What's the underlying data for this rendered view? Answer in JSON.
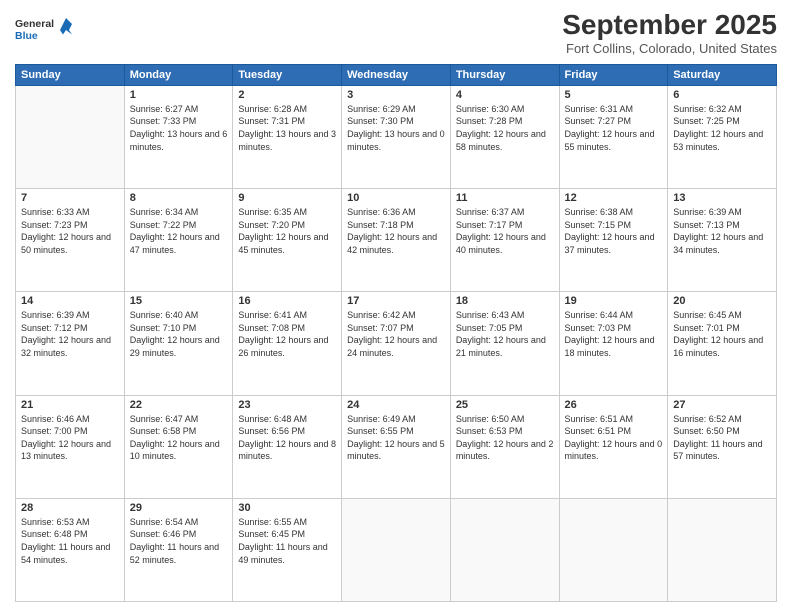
{
  "logo": {
    "line1": "General",
    "line2": "Blue"
  },
  "header": {
    "month": "September 2025",
    "location": "Fort Collins, Colorado, United States"
  },
  "weekdays": [
    "Sunday",
    "Monday",
    "Tuesday",
    "Wednesday",
    "Thursday",
    "Friday",
    "Saturday"
  ],
  "weeks": [
    [
      {
        "day": "",
        "sunrise": "",
        "sunset": "",
        "daylight": ""
      },
      {
        "day": "1",
        "sunrise": "Sunrise: 6:27 AM",
        "sunset": "Sunset: 7:33 PM",
        "daylight": "Daylight: 13 hours and 6 minutes."
      },
      {
        "day": "2",
        "sunrise": "Sunrise: 6:28 AM",
        "sunset": "Sunset: 7:31 PM",
        "daylight": "Daylight: 13 hours and 3 minutes."
      },
      {
        "day": "3",
        "sunrise": "Sunrise: 6:29 AM",
        "sunset": "Sunset: 7:30 PM",
        "daylight": "Daylight: 13 hours and 0 minutes."
      },
      {
        "day": "4",
        "sunrise": "Sunrise: 6:30 AM",
        "sunset": "Sunset: 7:28 PM",
        "daylight": "Daylight: 12 hours and 58 minutes."
      },
      {
        "day": "5",
        "sunrise": "Sunrise: 6:31 AM",
        "sunset": "Sunset: 7:27 PM",
        "daylight": "Daylight: 12 hours and 55 minutes."
      },
      {
        "day": "6",
        "sunrise": "Sunrise: 6:32 AM",
        "sunset": "Sunset: 7:25 PM",
        "daylight": "Daylight: 12 hours and 53 minutes."
      }
    ],
    [
      {
        "day": "7",
        "sunrise": "Sunrise: 6:33 AM",
        "sunset": "Sunset: 7:23 PM",
        "daylight": "Daylight: 12 hours and 50 minutes."
      },
      {
        "day": "8",
        "sunrise": "Sunrise: 6:34 AM",
        "sunset": "Sunset: 7:22 PM",
        "daylight": "Daylight: 12 hours and 47 minutes."
      },
      {
        "day": "9",
        "sunrise": "Sunrise: 6:35 AM",
        "sunset": "Sunset: 7:20 PM",
        "daylight": "Daylight: 12 hours and 45 minutes."
      },
      {
        "day": "10",
        "sunrise": "Sunrise: 6:36 AM",
        "sunset": "Sunset: 7:18 PM",
        "daylight": "Daylight: 12 hours and 42 minutes."
      },
      {
        "day": "11",
        "sunrise": "Sunrise: 6:37 AM",
        "sunset": "Sunset: 7:17 PM",
        "daylight": "Daylight: 12 hours and 40 minutes."
      },
      {
        "day": "12",
        "sunrise": "Sunrise: 6:38 AM",
        "sunset": "Sunset: 7:15 PM",
        "daylight": "Daylight: 12 hours and 37 minutes."
      },
      {
        "day": "13",
        "sunrise": "Sunrise: 6:39 AM",
        "sunset": "Sunset: 7:13 PM",
        "daylight": "Daylight: 12 hours and 34 minutes."
      }
    ],
    [
      {
        "day": "14",
        "sunrise": "Sunrise: 6:39 AM",
        "sunset": "Sunset: 7:12 PM",
        "daylight": "Daylight: 12 hours and 32 minutes."
      },
      {
        "day": "15",
        "sunrise": "Sunrise: 6:40 AM",
        "sunset": "Sunset: 7:10 PM",
        "daylight": "Daylight: 12 hours and 29 minutes."
      },
      {
        "day": "16",
        "sunrise": "Sunrise: 6:41 AM",
        "sunset": "Sunset: 7:08 PM",
        "daylight": "Daylight: 12 hours and 26 minutes."
      },
      {
        "day": "17",
        "sunrise": "Sunrise: 6:42 AM",
        "sunset": "Sunset: 7:07 PM",
        "daylight": "Daylight: 12 hours and 24 minutes."
      },
      {
        "day": "18",
        "sunrise": "Sunrise: 6:43 AM",
        "sunset": "Sunset: 7:05 PM",
        "daylight": "Daylight: 12 hours and 21 minutes."
      },
      {
        "day": "19",
        "sunrise": "Sunrise: 6:44 AM",
        "sunset": "Sunset: 7:03 PM",
        "daylight": "Daylight: 12 hours and 18 minutes."
      },
      {
        "day": "20",
        "sunrise": "Sunrise: 6:45 AM",
        "sunset": "Sunset: 7:01 PM",
        "daylight": "Daylight: 12 hours and 16 minutes."
      }
    ],
    [
      {
        "day": "21",
        "sunrise": "Sunrise: 6:46 AM",
        "sunset": "Sunset: 7:00 PM",
        "daylight": "Daylight: 12 hours and 13 minutes."
      },
      {
        "day": "22",
        "sunrise": "Sunrise: 6:47 AM",
        "sunset": "Sunset: 6:58 PM",
        "daylight": "Daylight: 12 hours and 10 minutes."
      },
      {
        "day": "23",
        "sunrise": "Sunrise: 6:48 AM",
        "sunset": "Sunset: 6:56 PM",
        "daylight": "Daylight: 12 hours and 8 minutes."
      },
      {
        "day": "24",
        "sunrise": "Sunrise: 6:49 AM",
        "sunset": "Sunset: 6:55 PM",
        "daylight": "Daylight: 12 hours and 5 minutes."
      },
      {
        "day": "25",
        "sunrise": "Sunrise: 6:50 AM",
        "sunset": "Sunset: 6:53 PM",
        "daylight": "Daylight: 12 hours and 2 minutes."
      },
      {
        "day": "26",
        "sunrise": "Sunrise: 6:51 AM",
        "sunset": "Sunset: 6:51 PM",
        "daylight": "Daylight: 12 hours and 0 minutes."
      },
      {
        "day": "27",
        "sunrise": "Sunrise: 6:52 AM",
        "sunset": "Sunset: 6:50 PM",
        "daylight": "Daylight: 11 hours and 57 minutes."
      }
    ],
    [
      {
        "day": "28",
        "sunrise": "Sunrise: 6:53 AM",
        "sunset": "Sunset: 6:48 PM",
        "daylight": "Daylight: 11 hours and 54 minutes."
      },
      {
        "day": "29",
        "sunrise": "Sunrise: 6:54 AM",
        "sunset": "Sunset: 6:46 PM",
        "daylight": "Daylight: 11 hours and 52 minutes."
      },
      {
        "day": "30",
        "sunrise": "Sunrise: 6:55 AM",
        "sunset": "Sunset: 6:45 PM",
        "daylight": "Daylight: 11 hours and 49 minutes."
      },
      {
        "day": "",
        "sunrise": "",
        "sunset": "",
        "daylight": ""
      },
      {
        "day": "",
        "sunrise": "",
        "sunset": "",
        "daylight": ""
      },
      {
        "day": "",
        "sunrise": "",
        "sunset": "",
        "daylight": ""
      },
      {
        "day": "",
        "sunrise": "",
        "sunset": "",
        "daylight": ""
      }
    ]
  ]
}
